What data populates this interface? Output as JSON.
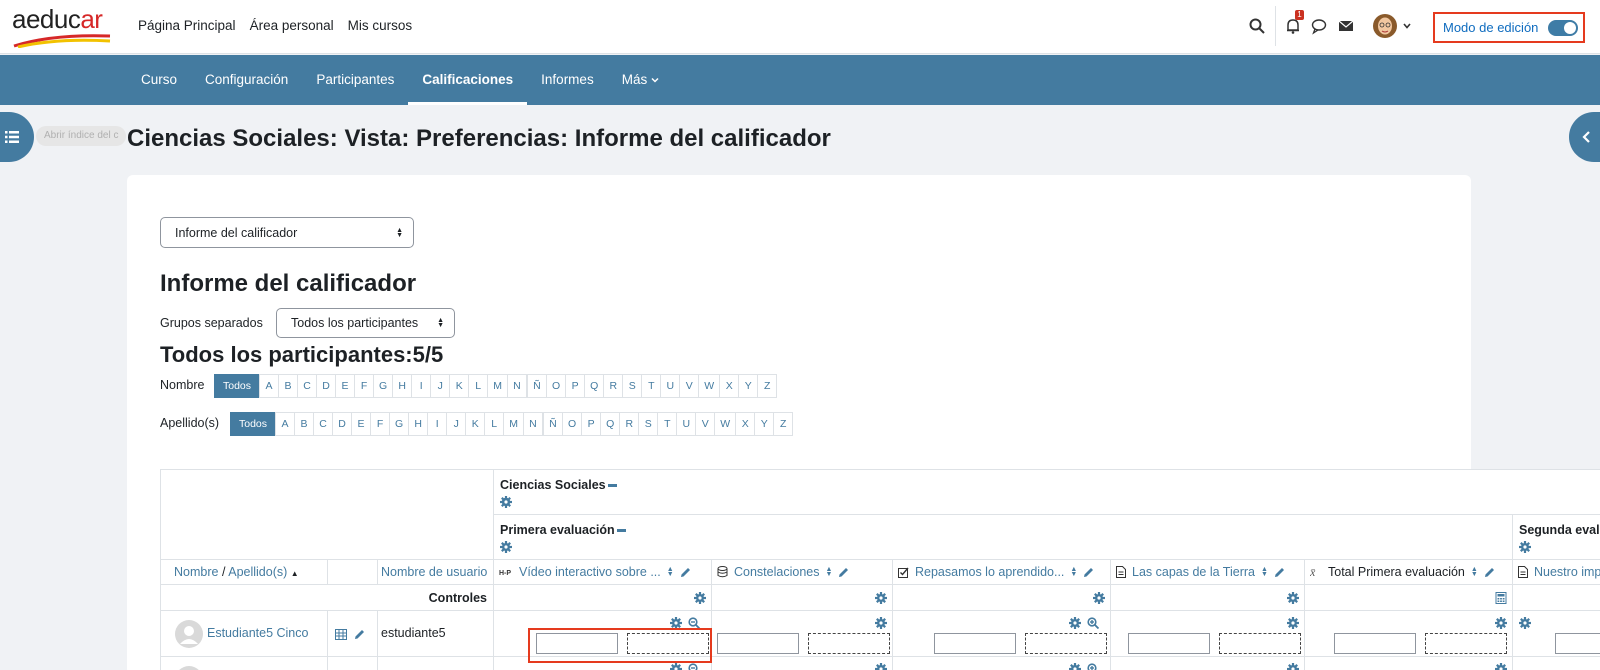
{
  "brand": {
    "logo_text_a": "aeduc",
    "logo_text_b": "ar"
  },
  "topnav": {
    "home": "Página Principal",
    "personal": "Área personal",
    "courses": "Mis cursos"
  },
  "notifications": {
    "count": "1"
  },
  "edit_mode": {
    "label": "Modo de edición",
    "on": true
  },
  "secnav": {
    "items": [
      "Curso",
      "Configuración",
      "Participantes",
      "Calificaciones",
      "Informes",
      "Más"
    ],
    "active": "Calificaciones"
  },
  "drawer": {
    "tooltip": "Abrir índice del c"
  },
  "page": {
    "title": "Ciencias Sociales: Vista: Preferencias: Informe del calificador"
  },
  "report_select": {
    "value": "Informe del calificador"
  },
  "report": {
    "heading": "Informe del calificador",
    "groups_label": "Grupos separados",
    "groups_value": "Todos los participantes",
    "participants_heading": "Todos los participantes:5/5"
  },
  "filters": {
    "first_name_label": "Nombre",
    "last_name_label": "Apellido(s)",
    "all": "Todos",
    "letters": [
      "A",
      "B",
      "C",
      "D",
      "E",
      "F",
      "G",
      "H",
      "I",
      "J",
      "K",
      "L",
      "M",
      "N",
      "Ñ",
      "O",
      "P",
      "Q",
      "R",
      "S",
      "T",
      "U",
      "V",
      "W",
      "X",
      "Y",
      "Z"
    ]
  },
  "grader": {
    "category_course": "Ciencias Sociales",
    "category_first": "Primera evaluación",
    "category_second": "Segunda evalu",
    "col_name": "Nombre",
    "col_sep": "/",
    "col_surname": "Apellido(s)",
    "col_username": "Nombre de usuario",
    "items": [
      "Vídeo interactivo sobre ...",
      "Constelaciones",
      "Repasamos lo aprendido...",
      "Las capas de la Tierra",
      "Total Primera evaluación",
      "Nuestro imp"
    ],
    "controls_label": "Controles",
    "student": {
      "name": "Estudiante5 Cinco",
      "username": "estudiante5"
    }
  },
  "colors": {
    "brand": "#447ba0",
    "highlight": "#e53a1e",
    "text": "#1d2125"
  }
}
